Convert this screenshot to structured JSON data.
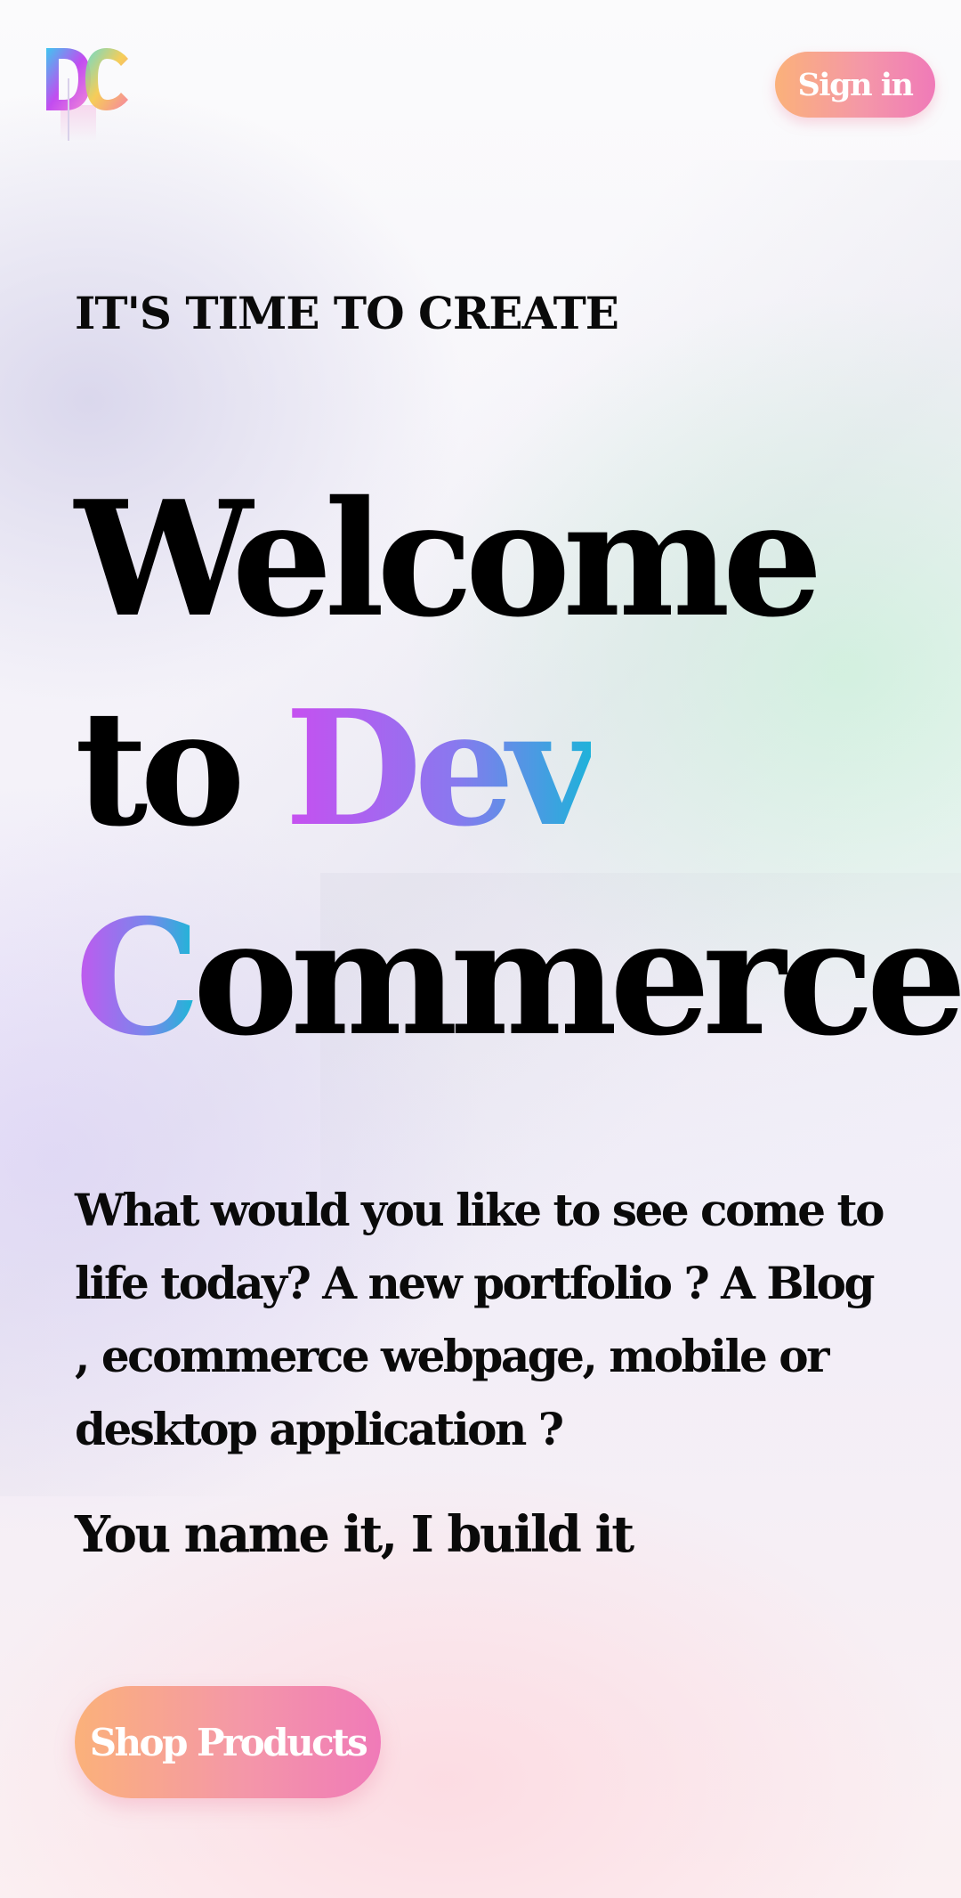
{
  "header": {
    "logo_text": "DC",
    "signin_label": "Sign in"
  },
  "hero": {
    "eyebrow": "IT'S TIME TO CREATE",
    "line1": "Welcome",
    "line2_prefix": "to ",
    "line2_highlight": "Dev",
    "line3_highlight": "C",
    "line3_rest": "ommerce"
  },
  "body": {
    "description": "What would you like to see come to life today? A new portfolio ? A Blog , ecommerce webpage, mobile or desktop application ?",
    "tagline": "You name it, I build it"
  },
  "cta": {
    "shop_label": "Shop Products"
  },
  "colors": {
    "brand_gradient_start": "#fbb17a",
    "brand_gradient_end": "#f07ab8",
    "title_gradient_start": "#c84ff0",
    "title_gradient_end": "#1fb2da"
  }
}
